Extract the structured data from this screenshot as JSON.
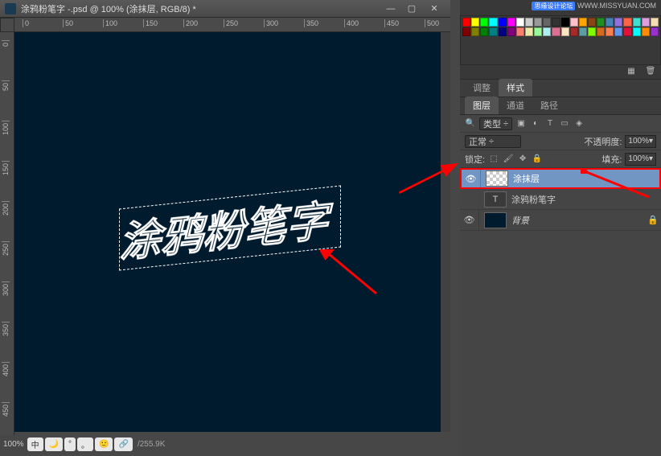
{
  "document": {
    "title": "涂鸦粉笔字 -.psd @ 100% (涂抹层, RGB/8) *",
    "zoom": "100%",
    "doc_size": "255.9K",
    "status_pills": [
      "中",
      "🌙",
      "°",
      "。",
      "🙂",
      "🔗"
    ]
  },
  "ruler_h": [
    "0",
    "50",
    "100",
    "150",
    "200",
    "250",
    "300",
    "350",
    "400",
    "450",
    "500"
  ],
  "ruler_v": [
    "0",
    "50",
    "100",
    "150",
    "200",
    "250",
    "300",
    "350",
    "400",
    "450"
  ],
  "canvas_text": "涂鸦粉笔字",
  "watermark": {
    "brand": "思缘设计论坛",
    "url": "WWW.MISSYUAN.COM"
  },
  "panel_group1": {
    "tab1": "调整",
    "tab2": "样式"
  },
  "layers_panel": {
    "tabs": {
      "tab1": "图层",
      "tab2": "通道",
      "tab3": "路径"
    },
    "filter": {
      "kind": "类型",
      "search_icon": "🔍"
    },
    "blend": {
      "mode": "正常",
      "opacity_label": "不透明度:",
      "opacity": "100%"
    },
    "lock": {
      "label": "锁定:",
      "fill_label": "填充:",
      "fill": "100%"
    },
    "layers": [
      {
        "name": "涂抹层",
        "type": "smudge",
        "selected": true,
        "visible": true
      },
      {
        "name": "涂鸦粉笔字",
        "type": "text",
        "selected": false,
        "visible": false
      },
      {
        "name": "背景",
        "type": "bg",
        "selected": false,
        "visible": true,
        "locked": true
      }
    ]
  },
  "swatch_colors": [
    "#f00",
    "#ff0",
    "#0f0",
    "#0ff",
    "#00f",
    "#f0f",
    "#fff",
    "#ccc",
    "#999",
    "#666",
    "#333",
    "#000",
    "#ffc0cb",
    "#ffa500",
    "#8b4513",
    "#228b22",
    "#4682b4",
    "#9370db",
    "#ff6347",
    "#40e0d0",
    "#dda0dd",
    "#f5deb3",
    "#800000",
    "#808000",
    "#008000",
    "#008080",
    "#000080",
    "#800080",
    "#fa8072",
    "#eee8aa",
    "#98fb98",
    "#afeeee",
    "#db7093",
    "#ffe4c4",
    "#a52a2a",
    "#5f9ea0",
    "#7fff00",
    "#d2691e",
    "#ff7f50",
    "#6495ed",
    "#dc143c",
    "#00ffff",
    "#ff8c00",
    "#9932cc"
  ]
}
